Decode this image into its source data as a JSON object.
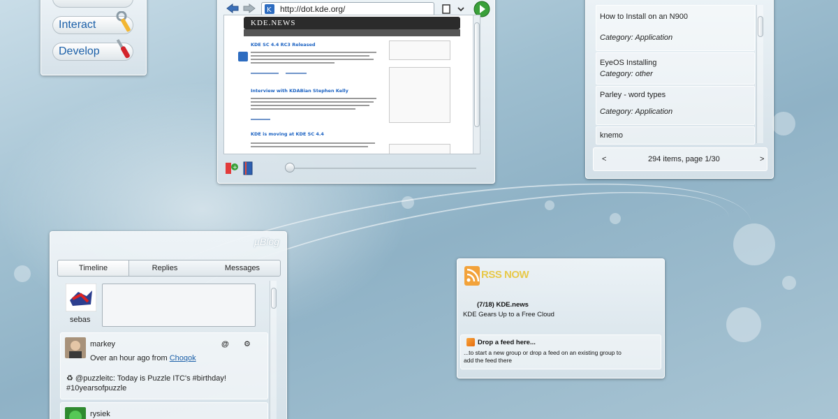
{
  "launcher": {
    "buttons": [
      {
        "label": "Interact",
        "icon": "wrench-icon"
      },
      {
        "label": "Develop",
        "icon": "screwdriver-icon"
      }
    ]
  },
  "browser": {
    "url": "http://dot.kde.org/",
    "site_banner": "KDE.NEWS",
    "articles": [
      {
        "title": "KDE SC 4.4 RC3 Released"
      },
      {
        "title": "Interview with KDABian Stephen Kelly"
      },
      {
        "title": "KDE is moving at KDE SC 4.4"
      }
    ]
  },
  "applist": {
    "items": [
      {
        "title": "How to Install on an N900",
        "category": "Category: Application"
      },
      {
        "title": "EyeOS Installing",
        "category": "Category: other"
      },
      {
        "title": "Parley - word types",
        "category": "Category: Application"
      },
      {
        "title": "knemo",
        "category": ""
      }
    ],
    "pager": {
      "prev": "<",
      "status": "294 items, page 1/30",
      "next": ">"
    }
  },
  "ublog": {
    "brand": "µBlog",
    "tabs": [
      "Timeline",
      "Replies",
      "Messages"
    ],
    "user": "sebas",
    "tweets": [
      {
        "user": "markey",
        "meta_prefix": "Over an hour ago from",
        "source": "Choqok",
        "text_line1": "♻ @puzzleitc: Today is Puzzle ITC's #birthday!",
        "text_line2": "#10yearsofpuzzle",
        "reply": "@",
        "action": "⚙"
      },
      {
        "user": "rysiek"
      }
    ]
  },
  "rss": {
    "brand": "RSS NOW",
    "entries": [
      {
        "title": "(7/18) KDE.news",
        "subtitle": "KDE Gears Up to a Free Cloud"
      },
      {
        "title": "Drop a feed here...",
        "subtitle_line1": "...to start a new group or drop a feed on an existing group to",
        "subtitle_line2": "add the feed there"
      }
    ]
  }
}
